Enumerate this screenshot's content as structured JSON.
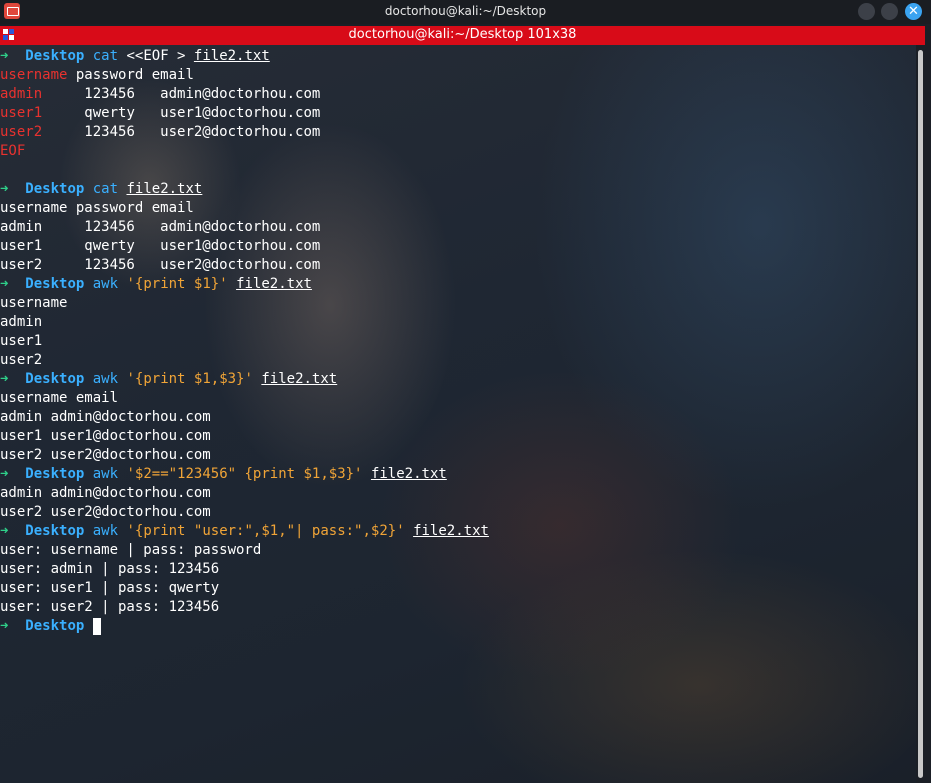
{
  "window": {
    "title": "doctorhou@kali:~/Desktop",
    "close_glyph": "✕"
  },
  "tab": {
    "title": "doctorhou@kali:~/Desktop 101x38"
  },
  "prompt": {
    "arrow": "➜",
    "dir": "Desktop"
  },
  "lines": {
    "l1": {
      "cmd": "cat",
      "pre": " <<EOF > ",
      "file": "file2.txt"
    },
    "l2": {
      "a": "username",
      "b": " password email"
    },
    "l3": {
      "a": "admin",
      "b": "     123456   admin@doctorhou.com"
    },
    "l4": {
      "a": "user1",
      "b": "     qwerty   user1@doctorhou.com"
    },
    "l5": {
      "a": "user2",
      "b": "     123456   user2@doctorhou.com"
    },
    "l6": {
      "a": "EOF"
    },
    "l8": {
      "cmd": "cat",
      "file": "file2.txt"
    },
    "l9": "username password email",
    "l10": "admin     123456   admin@doctorhou.com",
    "l11": "user1     qwerty   user1@doctorhou.com",
    "l12": "user2     123456   user2@doctorhou.com",
    "l13": {
      "cmd": "awk",
      "str": "'{print $1}'",
      "file": "file2.txt"
    },
    "l14": "username",
    "l15": "admin",
    "l16": "user1",
    "l17": "user2",
    "l18": {
      "cmd": "awk",
      "str": "'{print $1,$3}'",
      "file": "file2.txt"
    },
    "l19": "username email",
    "l20": "admin admin@doctorhou.com",
    "l21": "user1 user1@doctorhou.com",
    "l22": "user2 user2@doctorhou.com",
    "l23": {
      "cmd": "awk",
      "str": "'$2==\"123456\" {print $1,$3}'",
      "file": "file2.txt"
    },
    "l24": "admin admin@doctorhou.com",
    "l25": "user2 user2@doctorhou.com",
    "l26": {
      "cmd": "awk",
      "str": "'{print \"user:\",$1,\"| pass:\",$2}'",
      "file": "file2.txt"
    },
    "l27": "user: username | pass: password",
    "l28": "user: admin | pass: 123456",
    "l29": "user: user1 | pass: qwerty",
    "l30": "user: user2 | pass: 123456"
  },
  "colors": {
    "tabbar": "#d80b18",
    "prompt_arrow": "#2fd08a",
    "prompt_dir": "#3ab0ff",
    "string": "#f0a437",
    "heredoc_red": "#e8322f"
  }
}
